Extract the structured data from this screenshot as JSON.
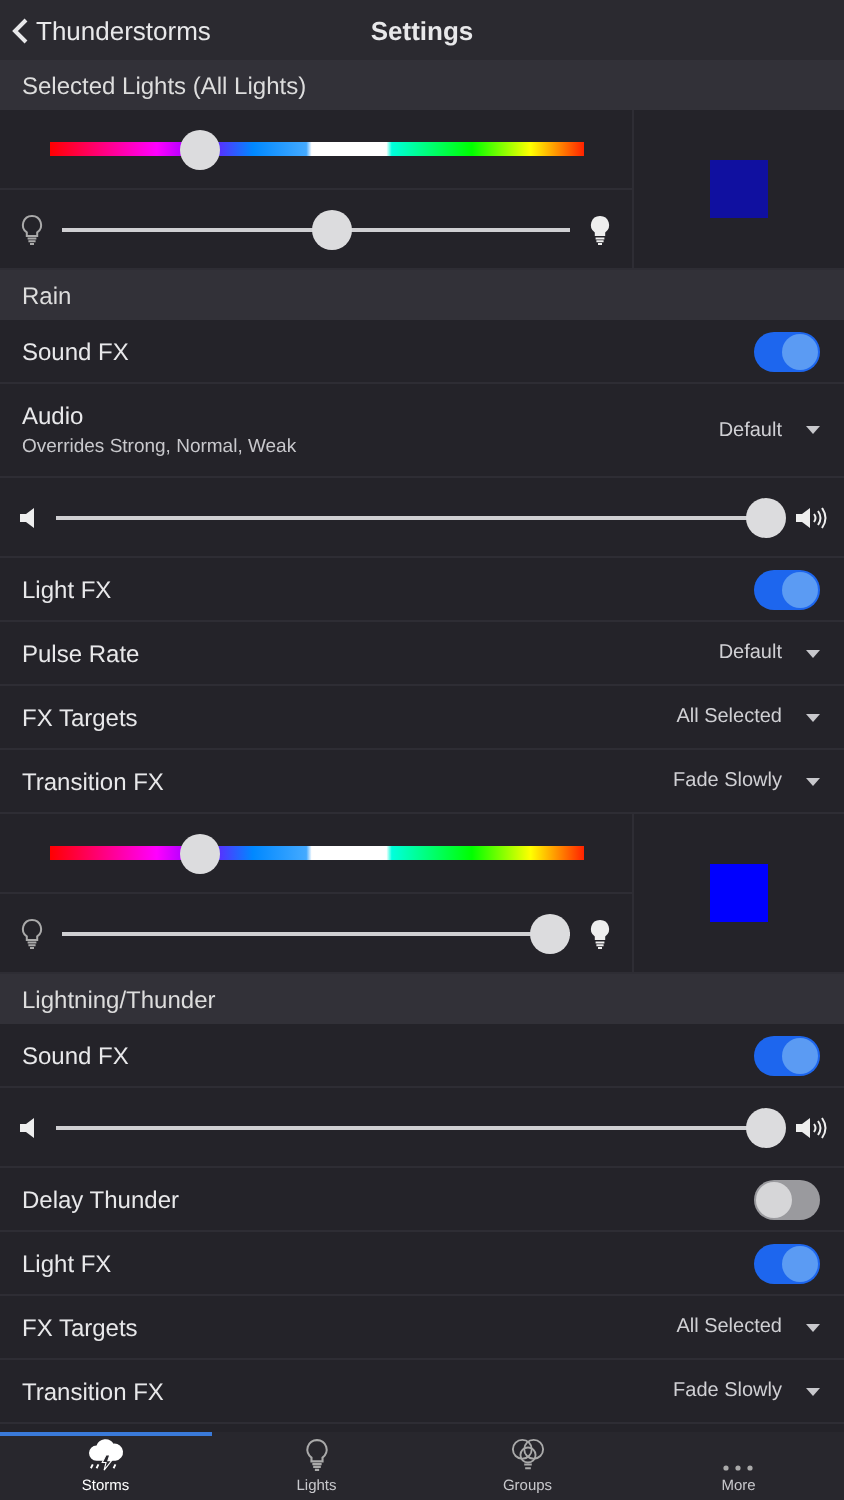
{
  "nav": {
    "back": "Thunderstorms",
    "title": "Settings"
  },
  "sections": [
    {
      "title": "Selected Lights (All Lights)",
      "rows": [
        {
          "kind": "color",
          "sliders": [
            {
              "level": 0.28
            },
            {
              "level": 0.53
            }
          ],
          "color": "#1010a0"
        }
      ]
    },
    {
      "title": "Rain",
      "rows": [
        {
          "kind": "toggle",
          "label": "Sound FX",
          "on": true
        },
        {
          "kind": "dropdown",
          "label": "Audio",
          "sublabel": "Overrides Strong, Normal, Weak",
          "value": "Default"
        },
        {
          "kind": "volume",
          "level": 0.98
        },
        {
          "kind": "toggle",
          "label": "Light FX",
          "on": true
        },
        {
          "kind": "dropdown",
          "label": "Pulse Rate",
          "value": "Default"
        },
        {
          "kind": "dropdown",
          "label": "FX Targets",
          "value": "All Selected"
        },
        {
          "kind": "dropdown",
          "label": "Transition FX",
          "value": "Fade Slowly"
        },
        {
          "kind": "color",
          "sliders": [
            {
              "level": 0.28
            },
            {
              "level": 0.96
            }
          ],
          "color": "#0000ff"
        }
      ]
    },
    {
      "title": "Lightning/Thunder",
      "rows": [
        {
          "kind": "toggle",
          "label": "Sound FX",
          "on": true
        },
        {
          "kind": "volume",
          "level": 0.98
        },
        {
          "kind": "toggle",
          "label": "Delay Thunder",
          "on": false
        },
        {
          "kind": "toggle",
          "label": "Light FX",
          "on": true
        },
        {
          "kind": "dropdown",
          "label": "FX Targets",
          "value": "All Selected"
        },
        {
          "kind": "dropdown",
          "label": "Transition FX",
          "value": "Fade Slowly"
        }
      ]
    }
  ],
  "tabs": [
    {
      "label": "Storms",
      "selected": true
    },
    {
      "label": "Lights",
      "selected": false
    },
    {
      "label": "Groups",
      "selected": false
    },
    {
      "label": "More",
      "selected": false
    }
  ]
}
